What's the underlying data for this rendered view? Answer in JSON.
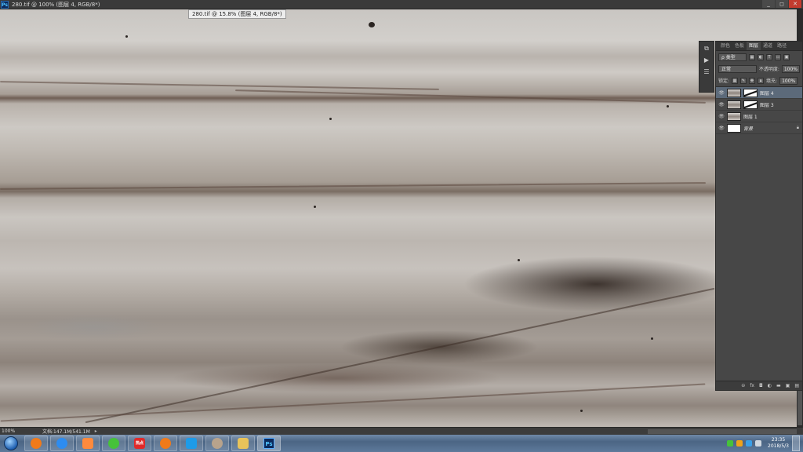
{
  "app": {
    "window_title": "280.tif @ 100% (图层 4, RGB/8*)",
    "doc_tab_label": "280.tif @ 15.8% (图层 4, RGB/8*)",
    "logo_text": "Ps",
    "window_buttons": [
      "_",
      "◻",
      "✕"
    ]
  },
  "layers_panel": {
    "tabs": [
      "颜色",
      "色板",
      "图层",
      "通道",
      "路径"
    ],
    "active_tab": "图层",
    "filter_label": "ρ 类型",
    "blend_mode": "正常",
    "opacity_label": "不透明度:",
    "opacity_value": "100%",
    "lock_label": "锁定:",
    "fill_label": "填充:",
    "fill_value": "100%",
    "layers": [
      {
        "name": "图层 4",
        "active": true,
        "thumb": "texture",
        "mask": true
      },
      {
        "name": "图层 3",
        "active": false,
        "thumb": "texture",
        "mask": true
      },
      {
        "name": "图层 1",
        "active": false,
        "thumb": "texture",
        "mask": false
      },
      {
        "name": "背景",
        "active": false,
        "thumb": "white",
        "mask": false,
        "italic": true,
        "locked": true
      }
    ],
    "footer_icons": [
      "link-icon",
      "fx-icon",
      "mask-icon",
      "adjustment-icon",
      "folder-icon",
      "new-layer-icon",
      "trash-icon"
    ],
    "footer_glyphs": [
      "⊝",
      "fx",
      "◘",
      "◐",
      "▬",
      "▣",
      "▤"
    ]
  },
  "status_bar": {
    "zoom": "100%",
    "doc_info": "文档:147.1M/541.1M",
    "arrow": "▸"
  },
  "taskbar": {
    "apps": [
      {
        "name": "browser-orange",
        "color": "#f07a1a"
      },
      {
        "name": "baidu-netdisk",
        "color": "#2d8cf0"
      },
      {
        "name": "camera-app",
        "color": "#ff8a3d"
      },
      {
        "name": "wechat",
        "color": "#46c23a"
      },
      {
        "name": "hotspot-news",
        "label": "热点",
        "color": "#e02a2a"
      },
      {
        "name": "browser-orange-2",
        "color": "#f07a1a"
      },
      {
        "name": "wave-app",
        "color": "#1e9be8"
      },
      {
        "name": "image-viewer",
        "color": "#b8a38c"
      },
      {
        "name": "file-explorer",
        "color": "#e8c35a"
      },
      {
        "name": "photoshop",
        "label": "Ps",
        "color": "#0c2a5c",
        "active": true
      }
    ],
    "clock_time": "23:35",
    "clock_date": "2018/5/3"
  },
  "colors": {
    "accent_active_layer": "#5c6a7a",
    "close_button": "#c33b2e",
    "badge_orange": "#e8701d"
  }
}
